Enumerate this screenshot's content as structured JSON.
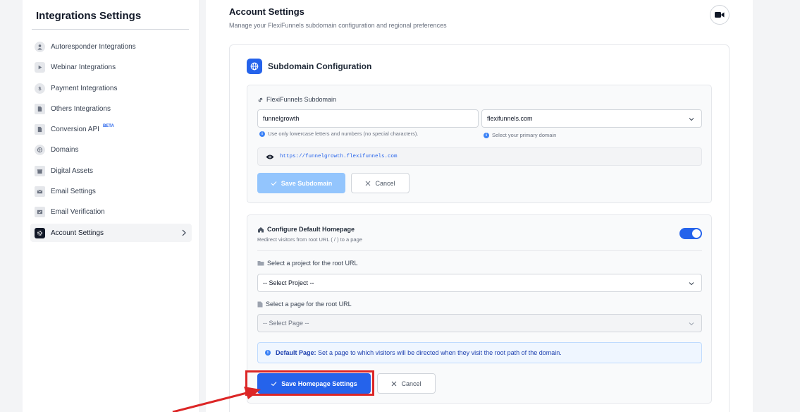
{
  "sidebar": {
    "title": "Integrations Settings",
    "items": [
      {
        "label": "Autoresponder Integrations",
        "icon": "user-icon"
      },
      {
        "label": "Webinar Integrations",
        "icon": "video-icon"
      },
      {
        "label": "Payment Integrations",
        "icon": "dollar-icon"
      },
      {
        "label": "Others Integrations",
        "icon": "file-icon"
      },
      {
        "label": "Conversion API",
        "icon": "file-icon",
        "badge": "BETA"
      },
      {
        "label": "Domains",
        "icon": "globe-icon"
      },
      {
        "label": "Digital Assets",
        "icon": "gift-icon"
      },
      {
        "label": "Email Settings",
        "icon": "mail-icon"
      },
      {
        "label": "Email Verification",
        "icon": "mail-check-icon"
      },
      {
        "label": "Account Settings",
        "icon": "gear-icon",
        "active": true
      }
    ]
  },
  "header": {
    "title": "Account Settings",
    "subtitle": "Manage your FlexiFunnels subdomain configuration and regional preferences"
  },
  "subdomain": {
    "section_title": "Subdomain Configuration",
    "field_label": "FlexiFunnels Subdomain",
    "subdomain_value": "funnelgrowth",
    "subdomain_hint": "Use only lowercase letters and numbers (no special characters).",
    "domain_value": "flexifunnels.com",
    "domain_hint": "Select your primary domain",
    "preview_url": "https://funnelgrowth.flexifunnels.com",
    "save_label": "Save Subdomain",
    "cancel_label": "Cancel"
  },
  "homepage": {
    "title": "Configure Default Homepage",
    "subtitle": "Redirect visitors from root URL ( / ) to a page",
    "toggle_on": true,
    "project_label": "Select a project for the root URL",
    "project_value": "-- Select Project --",
    "page_label": "Select a page for the root URL",
    "page_value": "-- Select Page --",
    "info_strong": "Default Page:",
    "info_text": "Set a page to which visitors will be directed when they visit the root path of the domain.",
    "save_label": "Save Homepage Settings",
    "cancel_label": "Cancel"
  },
  "colors": {
    "accent": "#2563eb",
    "highlight": "#dc2626"
  }
}
